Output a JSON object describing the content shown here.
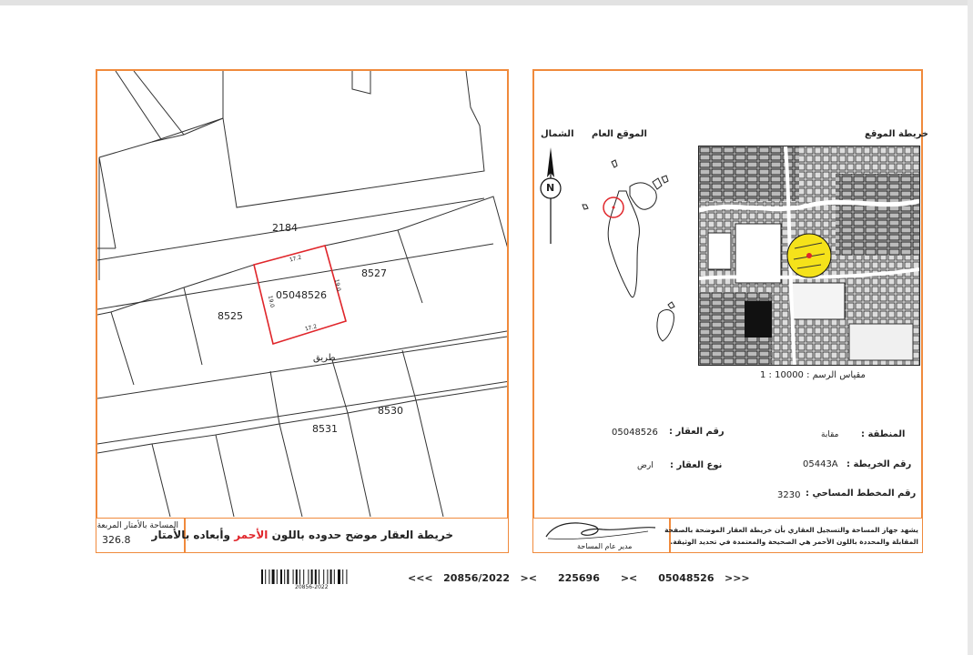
{
  "cadastral": {
    "road_number": "2184",
    "parcel_main": "05048526",
    "parcel_west": "8525",
    "parcel_east": "8527",
    "parcel_south_a": "8531",
    "parcel_south_b": "8530",
    "road_label": "طريق",
    "dim_top": "17.2",
    "dim_bottom": "17.2",
    "dim_left": "19.0",
    "dim_right": "19.0"
  },
  "footer_left": {
    "area_label": "المساحة بالأمتار المربعة",
    "area_value": "326.8",
    "caption_prefix": "خريطة العقار موضح حدوده باللون",
    "caption_red": "الأحمر",
    "caption_suffix": "وأبعاده بالأمتار"
  },
  "location": {
    "site_map_title": "خريطة الموقع",
    "general_location_title": "الموقع العام",
    "north_label": "الشمال",
    "north_letter": "N",
    "scale_label": "مقياس الرسم : 10000 : 1"
  },
  "info": {
    "property_number_label": "رقم العقار :",
    "property_number_value": "05048526",
    "area_label": "المنطقة :",
    "area_value": "مقابة",
    "property_type_label": "نوع العقار :",
    "property_type_value": "ارض",
    "map_number_label": "رقم الخريطة :",
    "map_number_value": "05443A",
    "survey_plan_label": "رقم المخطط المساحي :",
    "survey_plan_value": "3230"
  },
  "certification": {
    "line1": "يشهد جهاز المساحة والتسجيل العقاري بأن خريطة العقار الموضحة بالصفحة",
    "line2": "المقابلة والمحددة باللون الأحمر هي الصحيحة والمعتمدة في تحديد الوثيقة.",
    "signatory": "مدير عام المساحة"
  },
  "barcode": {
    "label": "20856-2022",
    "ref_sequence": "<<<   20856/2022   ><      225696      ><      05048526   >>>"
  },
  "colors": {
    "frame": "#f08a3c",
    "parcel_outline": "#e0262b",
    "highlight": "#f5e21a"
  }
}
